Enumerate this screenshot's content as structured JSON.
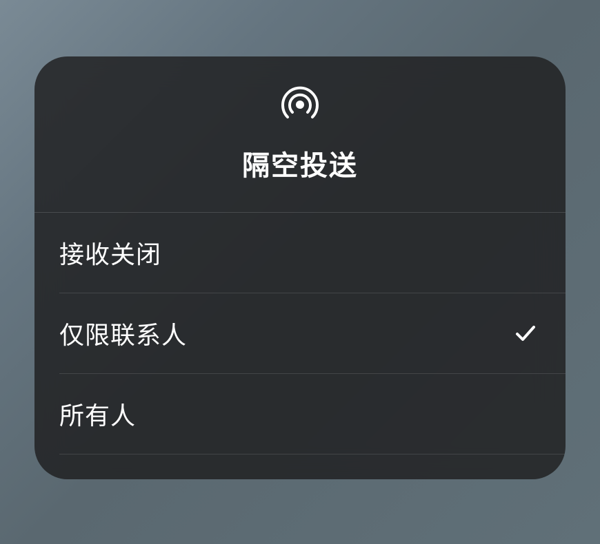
{
  "header": {
    "title": "隔空投送",
    "icon": "airdrop-icon"
  },
  "options": [
    {
      "label": "接收关闭",
      "selected": false
    },
    {
      "label": "仅限联系人",
      "selected": true
    },
    {
      "label": "所有人",
      "selected": false
    }
  ]
}
